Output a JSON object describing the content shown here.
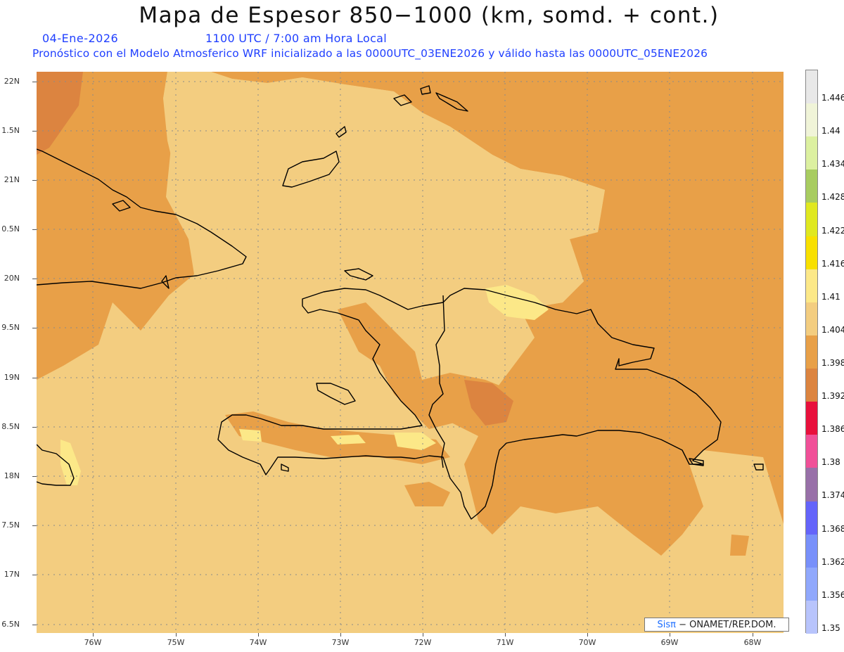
{
  "title": "Mapa de Espesor 850−1000 (km, somd. + cont.)",
  "date_label": "04-Ene-2026",
  "time_label": "1100 UTC / 7:00 am Hora Local",
  "description": "Pronóstico con el Modelo Atmosferico WRF inicializado a las 0000UTC_03ENE2026 y válido hasta las  0000UTC_05ENE2026",
  "lat_labels": [
    "22N",
    "1.5N",
    "21N",
    "0.5N",
    "20N",
    "9.5N",
    "19N",
    "8.5N",
    "18N",
    "7.5N",
    "17N",
    "6.5N"
  ],
  "lon_labels": [
    "76W",
    "75W",
    "74W",
    "73W",
    "72W",
    "71W",
    "70W",
    "69W",
    "68W"
  ],
  "colorbar": {
    "labels": [
      "1.446",
      "1.44",
      "1.434",
      "1.428",
      "1.422",
      "1.416",
      "1.41",
      "1.404",
      "1.398",
      "1.392",
      "1.386",
      "1.38",
      "1.374",
      "1.368",
      "1.362",
      "1.356",
      "1.35"
    ],
    "colors": [
      "#e8e8e8",
      "#f0f4d8",
      "#dcf0a0",
      "#a8cc60",
      "#e0e820",
      "#f8e000",
      "#fce888",
      "#f3cd80",
      "#e8a048",
      "#dc8440",
      "#e8103c",
      "#f05098",
      "#9870a8",
      "#6464fa",
      "#7890fa",
      "#90a8fc",
      "#b8c4fc"
    ]
  },
  "credit": {
    "brand": "Sisπ",
    "text": "ONAMET/REP.DOM."
  },
  "colors": {
    "title": "#111111",
    "subtitle": "#1f3fff",
    "band_1398": "#e8a048",
    "band_1404": "#f3cd80",
    "band_1410": "#fce888",
    "band_1392": "#dc8440"
  }
}
